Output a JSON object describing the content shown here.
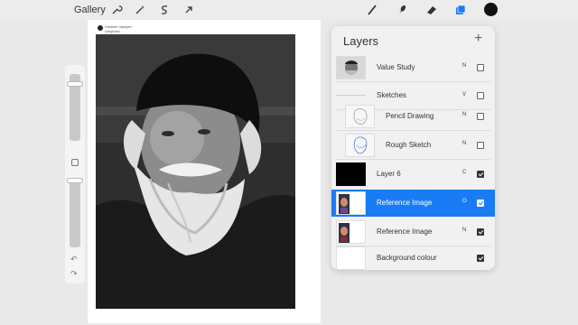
{
  "toolbar": {
    "gallery_label": "Gallery",
    "left_tools": [
      "wrench-icon",
      "magic-wand-icon",
      "selection-icon",
      "transform-arrow-icon"
    ],
    "right_tools": [
      "brush-icon",
      "smudge-icon",
      "eraser-icon",
      "layers-icon",
      "color-swatch"
    ],
    "accent_color": "#1a7cf5",
    "current_color": "#111111"
  },
  "canvas": {
    "credit_name": "Vladimir Vasilyev",
    "credit_sub": "Unsplash"
  },
  "sidebar": {
    "undo_icon": "↶",
    "redo_icon": "↷"
  },
  "layers": {
    "title": "Layers",
    "add_label": "+",
    "items": [
      {
        "name": "Value Study",
        "blend": "N",
        "visible": false,
        "thumb": "portrait",
        "active": false,
        "sub": false
      },
      {
        "name": "Sketches",
        "blend": "",
        "visible": false,
        "thumb": "group",
        "active": false,
        "sub": false
      },
      {
        "name": "Pencil Drawing",
        "blend": "N",
        "visible": false,
        "thumb": "sketch",
        "active": false,
        "sub": true
      },
      {
        "name": "Rough Sketch",
        "blend": "N",
        "visible": false,
        "thumb": "bluesketch",
        "active": false,
        "sub": true
      },
      {
        "name": "Layer 6",
        "blend": "C",
        "visible": true,
        "thumb": "black",
        "active": false,
        "sub": false
      },
      {
        "name": "Reference Image",
        "blend": "O",
        "visible": true,
        "thumb": "photo",
        "active": true,
        "sub": false
      },
      {
        "name": "Reference Image",
        "blend": "N",
        "visible": true,
        "thumb": "photo",
        "active": false,
        "sub": false
      },
      {
        "name": "Background colour",
        "blend": "",
        "visible": true,
        "thumb": "white",
        "active": false,
        "sub": false
      }
    ]
  }
}
